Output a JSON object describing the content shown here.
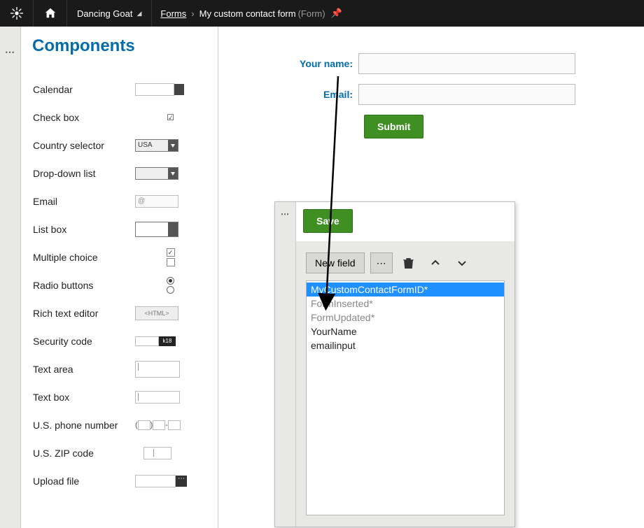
{
  "topbar": {
    "site_name": "Dancing Goat",
    "breadcrumb_root": "Forms",
    "breadcrumb_current": "My custom contact form",
    "breadcrumb_type": "(Form)"
  },
  "sidebar": {
    "title": "Components",
    "items": [
      {
        "label": "Calendar"
      },
      {
        "label": "Check box"
      },
      {
        "label": "Country selector",
        "value": "USA"
      },
      {
        "label": "Drop-down list"
      },
      {
        "label": "Email",
        "value": "@"
      },
      {
        "label": "List box"
      },
      {
        "label": "Multiple choice"
      },
      {
        "label": "Radio buttons"
      },
      {
        "label": "Rich text editor",
        "value": "<HTML>"
      },
      {
        "label": "Security code",
        "value": "k18"
      },
      {
        "label": "Text area"
      },
      {
        "label": "Text box"
      },
      {
        "label": "U.S. phone number"
      },
      {
        "label": "U.S. ZIP code"
      },
      {
        "label": "Upload file"
      }
    ]
  },
  "form": {
    "name_label": "Your name:",
    "email_label": "Email:",
    "submit_label": "Submit"
  },
  "editor": {
    "save_label": "Save",
    "newfield_label": "New field",
    "fields": [
      {
        "name": "MyCustomContactFormID*",
        "system": false,
        "selected": true
      },
      {
        "name": "FormInserted*",
        "system": true,
        "selected": false
      },
      {
        "name": "FormUpdated*",
        "system": true,
        "selected": false
      },
      {
        "name": "YourName",
        "system": false,
        "selected": false
      },
      {
        "name": "emailinput",
        "system": false,
        "selected": false
      }
    ]
  }
}
